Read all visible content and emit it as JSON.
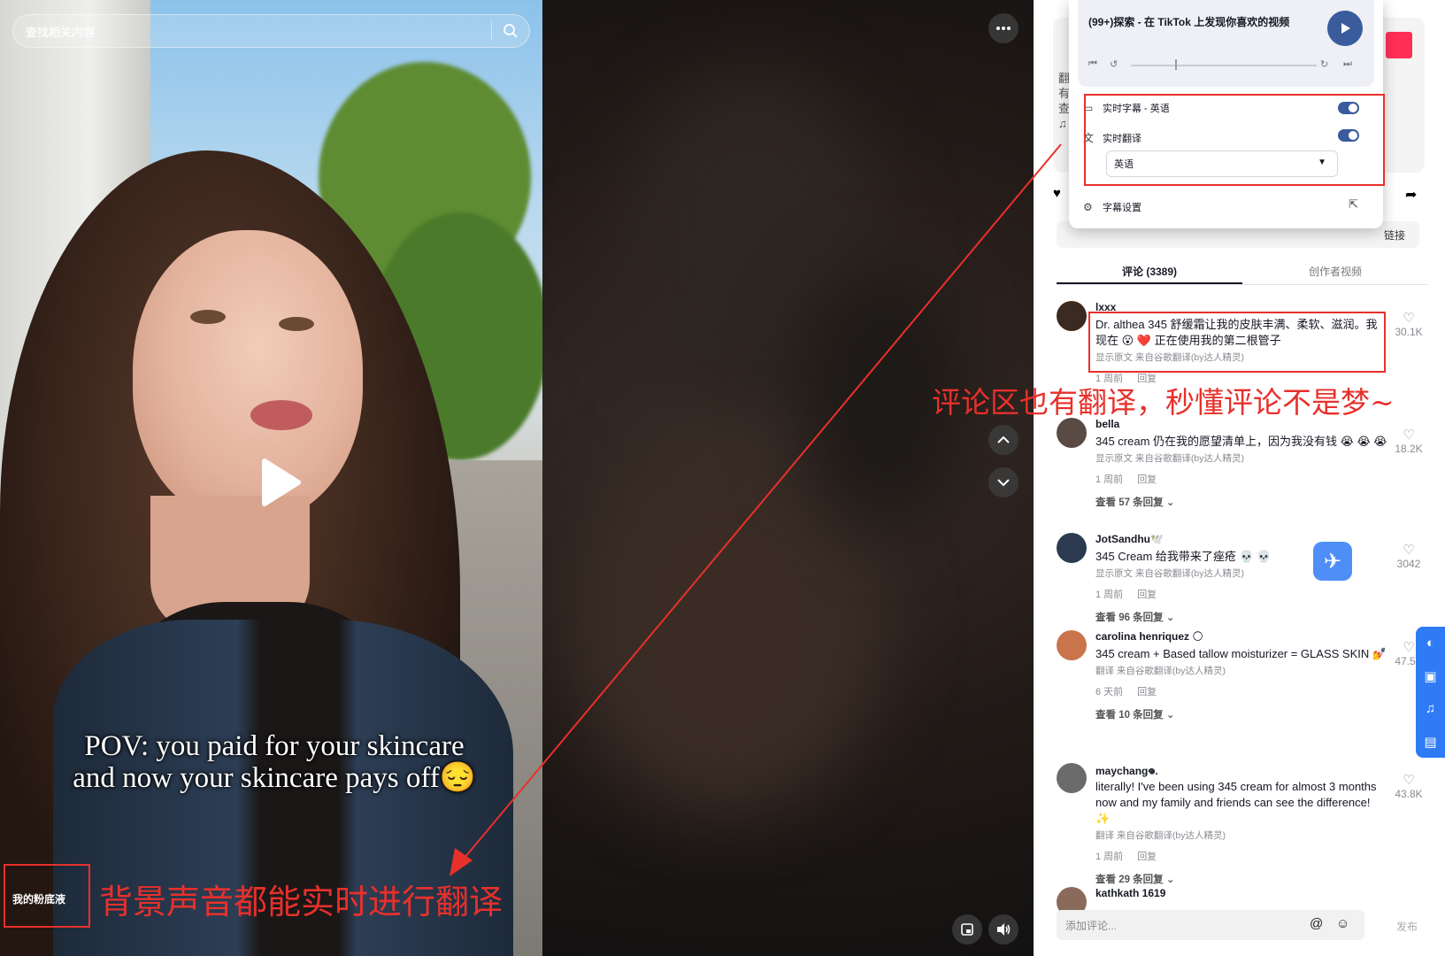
{
  "search": {
    "placeholder": "查找相关内容"
  },
  "video": {
    "caption_line1": "POV: you paid for your skincare",
    "caption_line2": "and now your skincare pays off😔",
    "sticker": "我的粉底液"
  },
  "annotations": {
    "bottom": "背景声音都能实时进行翻译",
    "right": "评论区也有翻译，秒懂评论不是梦~"
  },
  "popup": {
    "media_title": "(99+)探索 - 在 TikTok 上发现你喜欢的视频",
    "live_caption_label": "实时字幕 - 英语",
    "live_translate_label": "实时翻译",
    "language_value": "英语",
    "caption_settings_label": "字幕设置"
  },
  "panel": {
    "partial_text": [
      "翻",
      "有",
      "查"
    ],
    "link_label": "链接",
    "tabs": [
      {
        "label": "评论 (3389)",
        "active": true
      },
      {
        "label": "创作者视频",
        "active": false
      }
    ],
    "comments": [
      {
        "user": "lxxx",
        "text": "Dr. althea 345 舒缓霜让我的皮肤丰满、柔软、滋润。我现在 😮 ❤️ 正在使用我的第二根管子",
        "source": "显示原文  来自谷歌翻译(by达人精灵)",
        "time": "1 周前",
        "reply": "回复",
        "replies": "",
        "likes": "30.1K",
        "avatar": "#3a2a22"
      },
      {
        "user": "bella",
        "text": "345 cream 仍在我的愿望清单上，因为我没有钱 😭 😭 😭",
        "source": "显示原文  来自谷歌翻译(by达人精灵)",
        "time": "1 周前",
        "reply": "回复",
        "replies": "查看 57 条回复",
        "likes": "18.2K",
        "avatar": "#5a4a44"
      },
      {
        "user": "JotSandhu🕊️",
        "text": "345 Cream 给我带来了痤疮 💀 💀",
        "source": "显示原文  来自谷歌翻译(by达人精灵)",
        "time": "1 周前",
        "reply": "回复",
        "replies": "查看 96 条回复",
        "likes": "3042",
        "avatar": "#2b3a4e"
      },
      {
        "user": "carolina henriquez 🌕",
        "text": "345 cream + Based tallow moisturizer = GLASS SKIN 💅",
        "source": "翻译  来自谷歌翻译(by达人精灵)",
        "time": "6 天前",
        "reply": "回复",
        "replies": "查看 10 条回复",
        "likes": "47.5K",
        "avatar": "#c9744a"
      },
      {
        "user": "maychang𖦹.",
        "text": "literally! I've been using 345 cream for almost 3 months now and my family and friends can see the difference! ✨",
        "source": "翻译  来自谷歌翻译(by达人精灵)",
        "time": "1 周前",
        "reply": "回复",
        "replies": "查看 29 条回复",
        "likes": "43.8K",
        "avatar": "#6b6b6b"
      },
      {
        "user": "kathkath 1619",
        "text": "",
        "source": "",
        "time": "",
        "reply": "",
        "replies": "",
        "likes": "",
        "avatar": "#8a6a5a"
      }
    ],
    "comment_placeholder": "添加评论...",
    "post_label": "发布"
  },
  "colors": {
    "annotation_red": "#e8302b",
    "accent_blue": "#3a5b9c",
    "dock_blue": "#2f7bf6",
    "tiktok_red": "#ff2f55"
  }
}
